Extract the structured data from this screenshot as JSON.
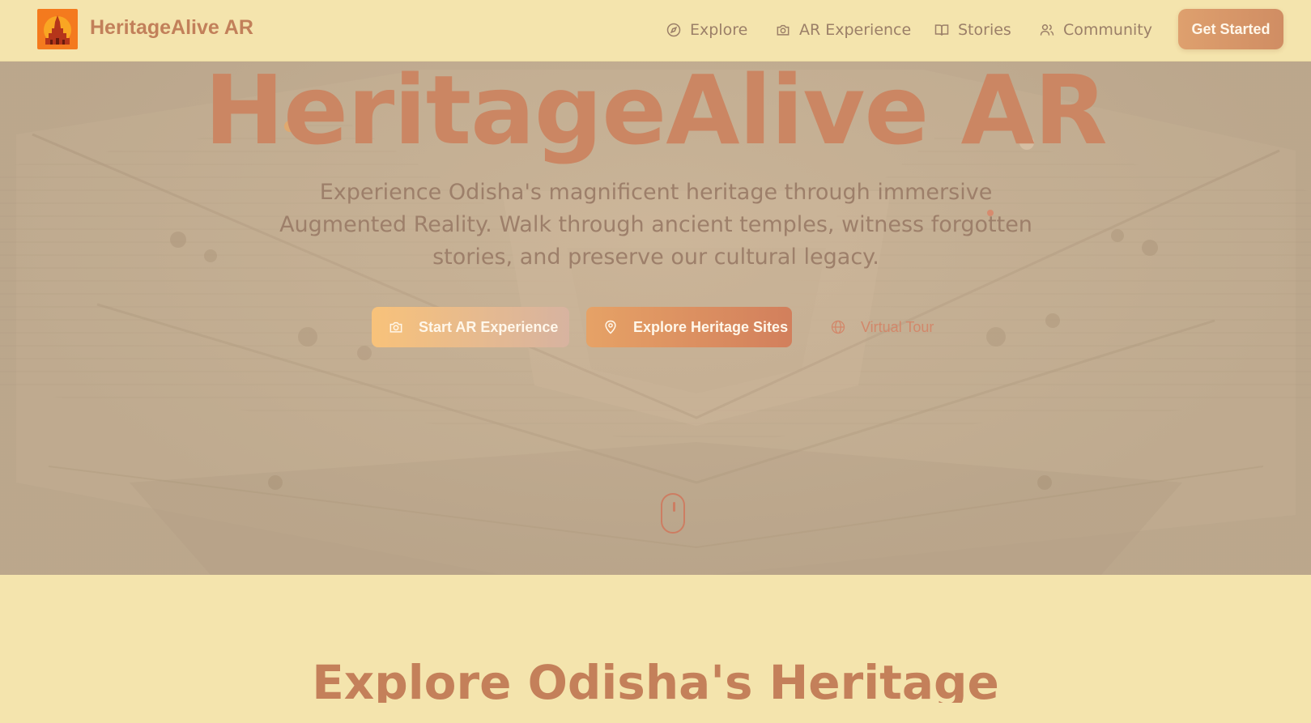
{
  "brand": {
    "name": "HeritageAlive AR",
    "logo_icon": "temple-icon"
  },
  "nav": {
    "items": [
      {
        "label": "Explore",
        "icon": "compass-icon"
      },
      {
        "label": "AR Experience",
        "icon": "camera-icon"
      },
      {
        "label": "Stories",
        "icon": "book-icon"
      },
      {
        "label": "Community",
        "icon": "users-icon"
      }
    ],
    "cta": "Get Started"
  },
  "hero": {
    "title": "HeritageAlive AR",
    "subtitle": "Experience Odisha's magnificent heritage through immersive Augmented Reality. Walk through ancient temples, witness forgotten stories, and preserve our cultural legacy.",
    "buttons": {
      "start_ar": {
        "label": "Start AR Experience",
        "icon": "camera-icon"
      },
      "explore_sites": {
        "label": "Explore Heritage Sites",
        "icon": "map-pin-icon"
      },
      "virtual_tour": {
        "label": "Virtual Tour",
        "icon": "globe-icon"
      }
    },
    "scroll_icon": "mouse-scroll-icon"
  },
  "explore_section": {
    "title": "Explore Odisha's Heritage"
  },
  "colors": {
    "background": "#f4e4ad",
    "accent": "#cb8663",
    "logo_bg": "#f47a1e",
    "nav_text": "#9b7f68"
  }
}
